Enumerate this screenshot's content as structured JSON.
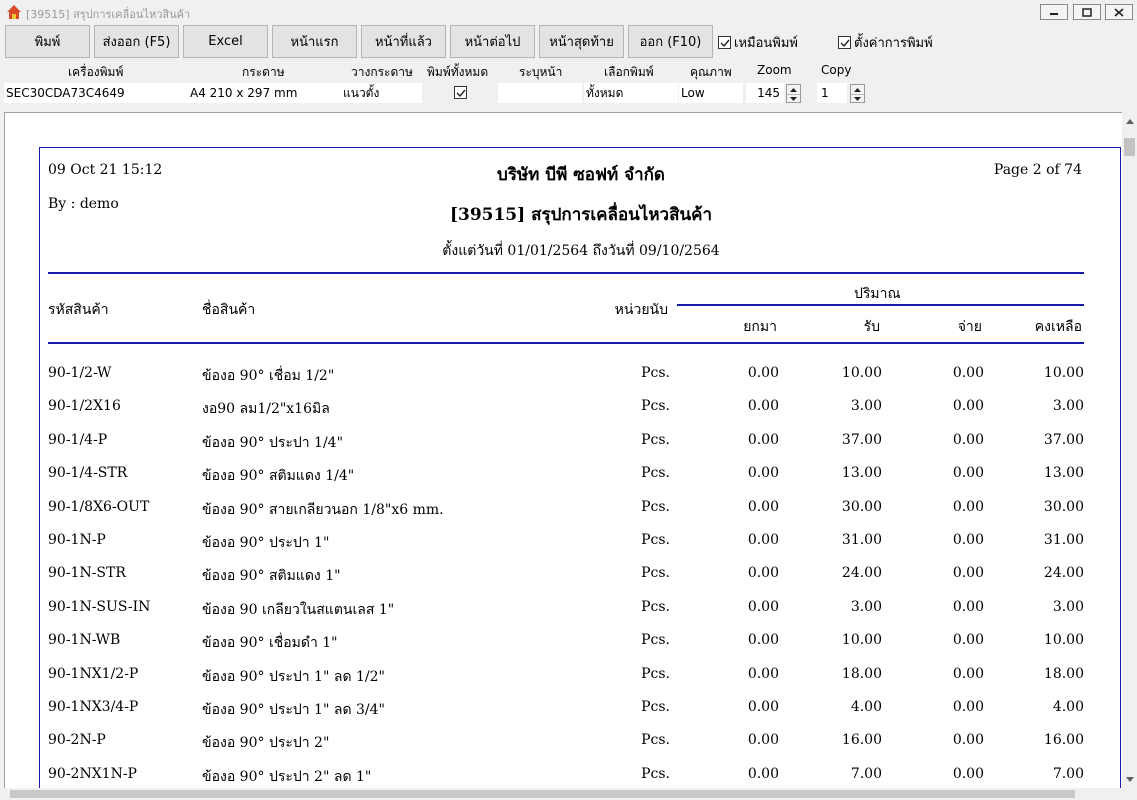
{
  "window": {
    "title": "[39515] สรุปการเคลื่อนไหวสินค้า"
  },
  "toolbar": {
    "print": "พิมพ์",
    "export": "ส่งออก (F5)",
    "excel": "Excel",
    "first_page": "หน้าแรก",
    "prev_page": "หน้าที่แล้ว",
    "next_page": "หน้าต่อไป",
    "last_page": "หน้าสุดท้าย",
    "exit": "ออก (F10)",
    "same_as_print": "เหมือนพิมพ์",
    "print_setup": "ตั้งค่าการพิมพ์",
    "same_as_print_checked": true,
    "print_setup_checked": true
  },
  "settings": {
    "printer_label": "เครื่องพิมพ์",
    "paper_label": "กระดาษ",
    "orientation_label": "วางกระดาษ",
    "print_all_label": "พิมพ์ทั้งหมด",
    "page_range_label": "ระบุหน้า",
    "print_select_label": "เลือกพิมพ์",
    "quality_label": "คุณภาพ",
    "zoom_label": "Zoom",
    "copy_label": "Copy",
    "printer": "SEC30CDA73C4649",
    "paper": "A4 210 x 297 mm",
    "orientation": "แนวตั้ง",
    "print_all_checked": true,
    "page_range": "",
    "print_select": "ทั้งหมด",
    "quality": "Low",
    "zoom": "145",
    "copy": "1"
  },
  "report": {
    "date": "09 Oct 21 15:12",
    "by": "By : demo",
    "page": "Page 2 of 74",
    "company": "บริษัท บีพี ซอฟท์ จำกัด",
    "title": "[39515] สรุปการเคลื่อนไหวสินค้า",
    "range": "ตั้งแต่วันที่ 01/01/2564   ถึงวันที่ 09/10/2564",
    "headers": {
      "code": "รหัสสินค้า",
      "name": "ชื่อสินค้า",
      "unit": "หน่วยนับ",
      "quantity": "ปริมาณ",
      "opening": "ยกมา",
      "in": "รับ",
      "out": "จ่าย",
      "balance": "คงเหลือ"
    },
    "rows": [
      {
        "code": "90-1/2-W",
        "name": "ข้องอ 90° เชื่อม 1/2\"",
        "unit": "Pcs.",
        "opening": "0.00",
        "in": "10.00",
        "out": "0.00",
        "balance": "10.00"
      },
      {
        "code": "90-1/2X16",
        "name": "งอ90 ลม1/2\"x16มิล",
        "unit": "Pcs.",
        "opening": "0.00",
        "in": "3.00",
        "out": "0.00",
        "balance": "3.00"
      },
      {
        "code": "90-1/4-P",
        "name": "ข้องอ 90° ประปา 1/4\"",
        "unit": "Pcs.",
        "opening": "0.00",
        "in": "37.00",
        "out": "0.00",
        "balance": "37.00"
      },
      {
        "code": "90-1/4-STR",
        "name": "ข้องอ 90° สติมแดง 1/4\"",
        "unit": "Pcs.",
        "opening": "0.00",
        "in": "13.00",
        "out": "0.00",
        "balance": "13.00"
      },
      {
        "code": "90-1/8X6-OUT",
        "name": "ข้องอ 90° สายเกลียวนอก 1/8\"x6 mm.",
        "unit": "Pcs.",
        "opening": "0.00",
        "in": "30.00",
        "out": "0.00",
        "balance": "30.00"
      },
      {
        "code": "90-1N-P",
        "name": "ข้องอ 90° ประปา 1\"",
        "unit": "Pcs.",
        "opening": "0.00",
        "in": "31.00",
        "out": "0.00",
        "balance": "31.00"
      },
      {
        "code": "90-1N-STR",
        "name": "ข้องอ 90° สติมแดง 1\"",
        "unit": "Pcs.",
        "opening": "0.00",
        "in": "24.00",
        "out": "0.00",
        "balance": "24.00"
      },
      {
        "code": "90-1N-SUS-IN",
        "name": "ข้องอ 90 เกลียวในสแตนเลส 1\"",
        "unit": "Pcs.",
        "opening": "0.00",
        "in": "3.00",
        "out": "0.00",
        "balance": "3.00"
      },
      {
        "code": "90-1N-WB",
        "name": "ข้องอ 90° เชื่อมดำ 1\"",
        "unit": "Pcs.",
        "opening": "0.00",
        "in": "10.00",
        "out": "0.00",
        "balance": "10.00"
      },
      {
        "code": "90-1NX1/2-P",
        "name": "ข้องอ 90° ประปา 1\" ลด 1/2\"",
        "unit": "Pcs.",
        "opening": "0.00",
        "in": "18.00",
        "out": "0.00",
        "balance": "18.00"
      },
      {
        "code": "90-1NX3/4-P",
        "name": "ข้องอ 90° ประปา 1\" ลด 3/4\"",
        "unit": "Pcs.",
        "opening": "0.00",
        "in": "4.00",
        "out": "0.00",
        "balance": "4.00"
      },
      {
        "code": "90-2N-P",
        "name": "ข้องอ 90° ประปา 2\"",
        "unit": "Pcs.",
        "opening": "0.00",
        "in": "16.00",
        "out": "0.00",
        "balance": "16.00"
      },
      {
        "code": "90-2NX1N-P",
        "name": "ข้องอ 90° ประปา 2\" ลด 1\"",
        "unit": "Pcs.",
        "opening": "0.00",
        "in": "7.00",
        "out": "0.00",
        "balance": "7.00"
      }
    ]
  }
}
